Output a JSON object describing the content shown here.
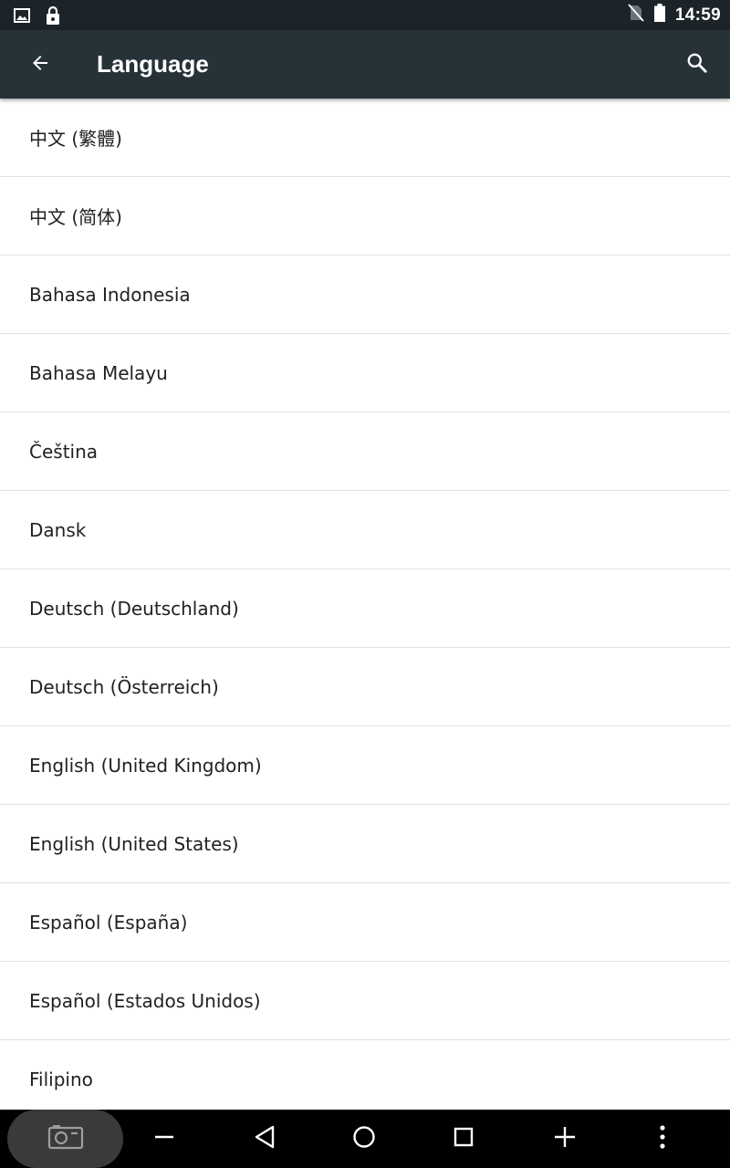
{
  "status_bar": {
    "time": "14:59",
    "left_icons": [
      "image-icon",
      "lock-icon"
    ],
    "right_icons": [
      "no-sim-icon",
      "battery-icon"
    ]
  },
  "app_bar": {
    "title": "Language",
    "back_icon": "arrow-back-icon",
    "search_icon": "search-icon"
  },
  "languages": [
    "中文 (繁體)",
    "中文 (简体)",
    "Bahasa Indonesia",
    "Bahasa Melayu",
    "Čeština",
    "Dansk",
    "Deutsch (Deutschland)",
    "Deutsch (Österreich)",
    "English (United Kingdom)",
    "English (United States)",
    "Español (España)",
    "Español (Estados Unidos)",
    "Filipino"
  ],
  "nav_bar": {
    "buttons": [
      "screenshot-icon",
      "volume-down-icon",
      "back-triangle-icon",
      "home-circle-icon",
      "recents-square-icon",
      "volume-up-icon",
      "more-vert-icon"
    ]
  },
  "colors": {
    "status_bar_bg": "#1c2429",
    "app_bar_bg": "#263238",
    "nav_bar_bg": "#000000",
    "divider": "#e0e0e0",
    "text_primary": "#212121"
  }
}
